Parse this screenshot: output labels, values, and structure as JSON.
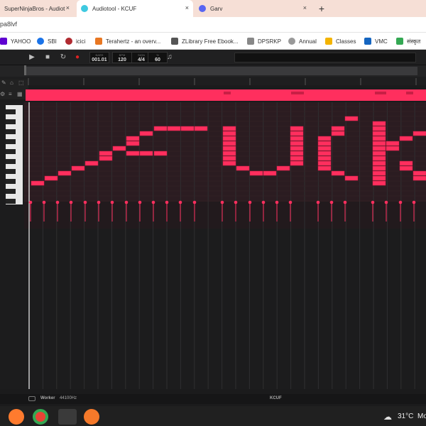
{
  "tabs": [
    {
      "label": "SuperNinjaBros - Audiot",
      "icon": "audiotool-icon",
      "active": false
    },
    {
      "label": "Audiotool - KCUF",
      "icon": "audiotool-icon",
      "active": true
    },
    {
      "label": "Garv",
      "icon": "discord-icon",
      "active": false
    }
  ],
  "tab_close": "×",
  "new_tab": "+",
  "url": "pa8lvf",
  "bookmarks": [
    {
      "label": "YAHOO",
      "icon": "yahoo-icon",
      "color": "#5f01d1"
    },
    {
      "label": "SBI",
      "icon": "sbi-icon",
      "color": "#1a73e8"
    },
    {
      "label": "icici",
      "icon": "icici-icon",
      "color": "#b02a30"
    },
    {
      "label": "Terahertz - an overv...",
      "icon": "elsevier-icon",
      "color": "#e87722"
    },
    {
      "label": "ZLibrary Free Ebook...",
      "icon": "zlibrary-icon",
      "color": "#555555"
    },
    {
      "label": "DPSRKP",
      "icon": "dpsrkp-icon",
      "color": "#888888"
    },
    {
      "label": "Annual",
      "icon": "bulb-icon",
      "color": "#999999"
    },
    {
      "label": "Classes",
      "icon": "classroom-icon",
      "color": "#f4b400"
    },
    {
      "label": "VMC",
      "icon": "vmc-icon",
      "color": "#1565c0"
    },
    {
      "label": "संस्कृत",
      "icon": "drive-icon",
      "color": "#34a853"
    }
  ],
  "transport": {
    "bars_label": "BARS",
    "bars_value": "001.01",
    "bpm_label": "BPM",
    "bpm_value": "120",
    "sign_label": "SIGN",
    "sign_value": "4/4",
    "swing_label": "%",
    "swing_value": "60"
  },
  "status": {
    "worker": "Worker",
    "rate": "44100Hz",
    "project": "KCUF"
  },
  "taskbar": {
    "weather": "31°C",
    "extra": "Mo"
  },
  "colors": {
    "note": "#ff2f5e",
    "note_dark": "#c91f45",
    "grid_bg": "#2a1a1f",
    "accent": "#ff3366"
  }
}
